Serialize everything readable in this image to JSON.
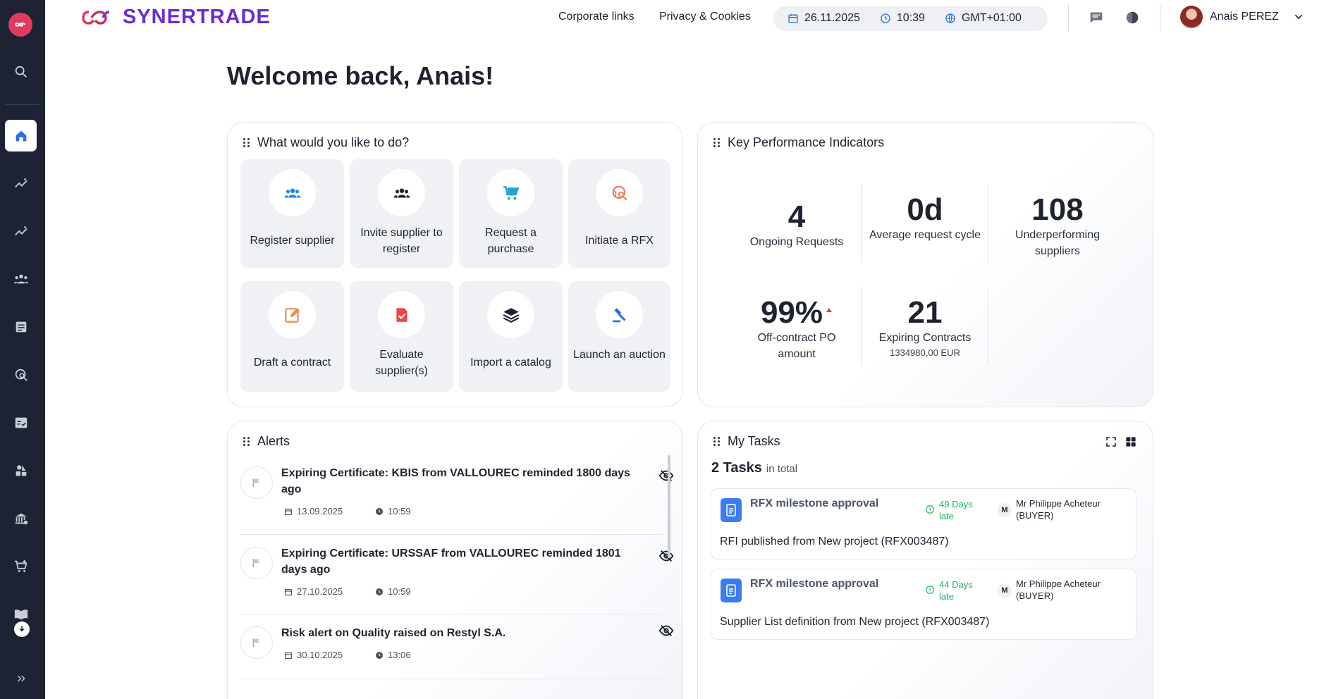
{
  "brand": {
    "name": "SYNERTRADE"
  },
  "header": {
    "links": [
      "Corporate links",
      "Privacy & Cookies"
    ],
    "date": "26.11.2025",
    "time": "10:39",
    "timezone": "GMT+01:00",
    "user_name": "Anais PEREZ"
  },
  "welcome": "Welcome back, Anais!",
  "actions_card": {
    "title": "What would you like to do?",
    "items": [
      {
        "label": "Register supplier",
        "icon": "users-icon",
        "color": "#1d84e0"
      },
      {
        "label": "Invite supplier to register",
        "icon": "users-icon",
        "color": "#1f2330"
      },
      {
        "label": "Request a purchase",
        "icon": "cart-icon",
        "color": "#1fa2d8"
      },
      {
        "label": "Initiate a RFX",
        "icon": "search-globe-icon",
        "color": "#f07a55"
      },
      {
        "label": "Draft a contract",
        "icon": "edit-icon",
        "color": "#f08a4a"
      },
      {
        "label": "Evaluate supplier(s)",
        "icon": "doc-check-icon",
        "color": "#e84848"
      },
      {
        "label": "Import a catalog",
        "icon": "layers-icon",
        "color": "#1f2330"
      },
      {
        "label": "Launch an auction",
        "icon": "gavel-icon",
        "color": "#2c6ee0"
      }
    ]
  },
  "kpi_card": {
    "title": "Key Performance Indicators",
    "items": [
      {
        "value": "4",
        "label": "Ongoing Requests"
      },
      {
        "value": "0d",
        "label": "Average request cycle"
      },
      {
        "value": "108",
        "label": "Underperforming suppliers"
      },
      {
        "value": "99%",
        "label": "Off-contract PO amount"
      },
      {
        "value": "21",
        "label": "Expiring Contracts",
        "sub": "1334980,00 EUR"
      }
    ],
    "trend_color": "#e03a3a"
  },
  "alerts_card": {
    "title": "Alerts",
    "items": [
      {
        "title": "Expiring Certificate: KBIS from VALLOUREC reminded 1800 days ago",
        "date": "13.09.2025",
        "time": "10:59"
      },
      {
        "title": "Expiring Certificate: URSSAF from VALLOUREC reminded 1801 days ago",
        "date": "27.10.2025",
        "time": "10:59"
      },
      {
        "title": "Risk alert on Quality raised on Restyl S.A.",
        "date": "30.10.2025",
        "time": "13:06"
      }
    ]
  },
  "tasks_card": {
    "title": "My Tasks",
    "count": "2 Tasks",
    "count_suffix": "in total",
    "items": [
      {
        "title": "RFX milestone approval",
        "late_days": "49 Days",
        "late_label": "late",
        "assignee_initial": "M",
        "assignee_name": "Mr Philippe Acheteur",
        "assignee_role": "(BUYER)",
        "desc": "RFI published from New project (RFX003487)"
      },
      {
        "title": "RFX milestone approval",
        "late_days": "44 Days",
        "late_label": "late",
        "assignee_initial": "M",
        "assignee_name": "Mr Philippe Acheteur",
        "assignee_role": "(BUYER)",
        "desc": "Supplier List definition from New project (RFX003487)"
      }
    ]
  },
  "colors": {
    "sidebar": "#1d2333",
    "brand": "#6b2bd1",
    "accent_red": "#e03a5e"
  }
}
